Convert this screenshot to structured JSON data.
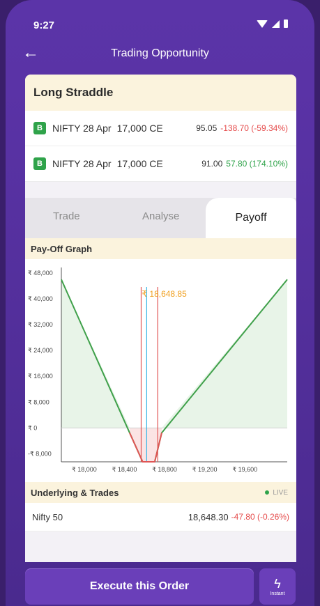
{
  "status_bar": {
    "time": "9:27"
  },
  "header": {
    "title": "Trading Opportunity"
  },
  "strategy": {
    "name": "Long Straddle",
    "legs": [
      {
        "side": "B",
        "symbol": "NIFTY 28 Apr",
        "strike": "17,000 CE",
        "ltp": "95.05",
        "change": "-138.70 (-59.34%)",
        "direction": "down"
      },
      {
        "side": "B",
        "symbol": "NIFTY 28 Apr",
        "strike": "17,000 CE",
        "ltp": "91.00",
        "change": "57.80 (174.10%)",
        "direction": "up"
      }
    ]
  },
  "tabs": {
    "trade": "Trade",
    "analyse": "Analyse",
    "payoff": "Payoff",
    "active": "Payoff"
  },
  "payoff": {
    "section_title": "Pay-Off Graph",
    "spot_label": "₹ 18,648.85"
  },
  "chart_data": {
    "type": "line",
    "y_ticks": [
      "₹ 48,000",
      "₹ 40,000",
      "₹ 32,000",
      "₹ 24,000",
      "₹ 16,000",
      "₹ 8,000",
      "₹ 0",
      "-₹ 8,000"
    ],
    "y_values": [
      48000,
      40000,
      32000,
      24000,
      16000,
      8000,
      0,
      -8000
    ],
    "x_ticks": [
      "₹ 18,000",
      "₹ 18,400",
      "₹ 18,800",
      "₹ 19,200",
      "₹ 19,600"
    ],
    "x_values": [
      18000,
      18400,
      18800,
      19200,
      19600
    ],
    "xlim": [
      17750,
      20000
    ],
    "ylim": [
      -10500,
      48000
    ],
    "series": [
      {
        "x": [
          17750,
          18430,
          18560,
          18680,
          18750,
          20000
        ],
        "y": [
          46000,
          -1500,
          -10500,
          -10500,
          -1500,
          46000
        ]
      }
    ],
    "vertical_lines": [
      {
        "x": 18710,
        "color": "#e05555"
      },
      {
        "x": 18545,
        "color": "#e05555"
      },
      {
        "x": 18600,
        "color": "#3bb7e6"
      }
    ],
    "spot_x": 18648.85,
    "colors": {
      "payoff_line": "#3fa04a",
      "profit_fill": "#e8f4e8",
      "loss_fill": "#fbe4e4"
    }
  },
  "underlying": {
    "section_title": "Underlying & Trades",
    "live_label": "LIVE",
    "name": "Nifty 50",
    "price": "18,648.30",
    "change": "-47.80 (-0.26%)"
  },
  "footer": {
    "execute_label": "Execute this Order",
    "instant_label": "Instant"
  }
}
